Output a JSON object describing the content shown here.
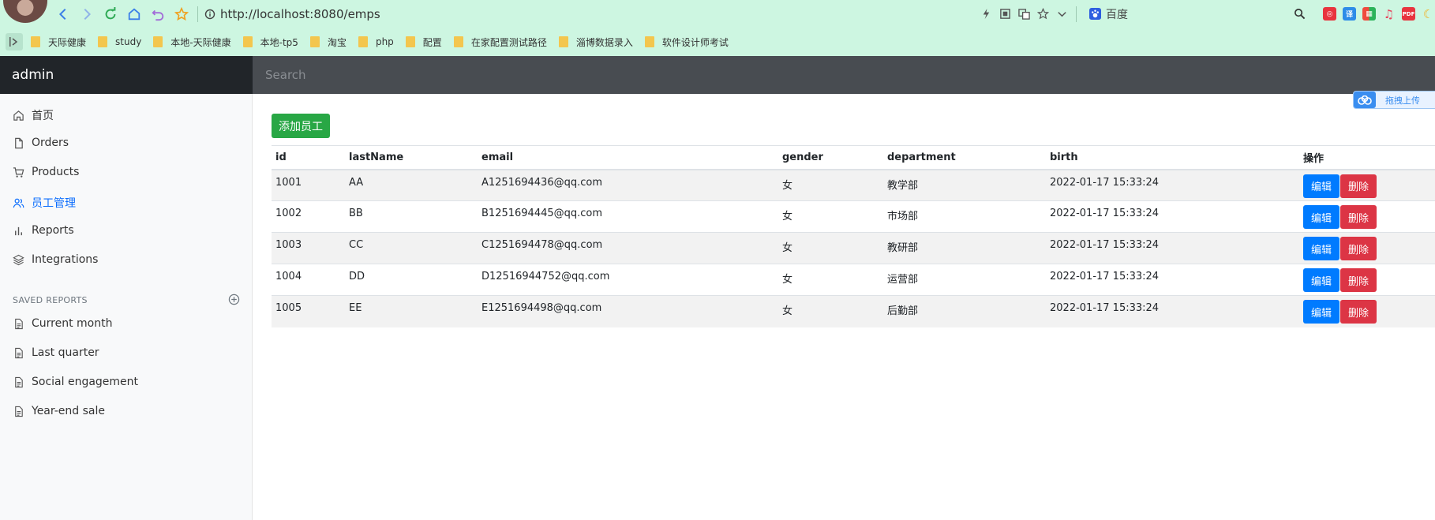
{
  "browser": {
    "url": "http://localhost:8080/emps",
    "search_engine": "百度",
    "bookmarks": [
      "天际健康",
      "study",
      "本地-天际健康",
      "本地-tp5",
      "淘宝",
      "php",
      "配置",
      "在家配置测试路径",
      "淄博数据录入",
      "软件设计师考试"
    ],
    "pdf_ext_label": "PDF"
  },
  "app": {
    "brand": "admin",
    "search_placeholder": "Search"
  },
  "sidebar": {
    "items": [
      {
        "label": "首页",
        "icon": "home-icon"
      },
      {
        "label": "Orders",
        "icon": "file-icon"
      },
      {
        "label": "Products",
        "icon": "cart-icon"
      },
      {
        "label": "员工管理",
        "icon": "users-icon"
      },
      {
        "label": "Reports",
        "icon": "bar-chart-icon"
      },
      {
        "label": "Integrations",
        "icon": "layers-icon"
      }
    ],
    "saved_heading": "SAVED REPORTS",
    "saved_reports": [
      "Current month",
      "Last quarter",
      "Social engagement",
      "Year-end sale"
    ]
  },
  "main": {
    "add_button": "添加员工",
    "table": {
      "headers": [
        "id",
        "lastName",
        "email",
        "gender",
        "department",
        "birth",
        "操作"
      ],
      "rows": [
        [
          "1001",
          "AA",
          "A1251694436@qq.com",
          "女",
          "教学部",
          "2022-01-17 15:33:24"
        ],
        [
          "1002",
          "BB",
          "B1251694445@qq.com",
          "女",
          "市场部",
          "2022-01-17 15:33:24"
        ],
        [
          "1003",
          "CC",
          "C1251694478@qq.com",
          "女",
          "教研部",
          "2022-01-17 15:33:24"
        ],
        [
          "1004",
          "DD",
          "D12516944752@qq.com",
          "女",
          "运营部",
          "2022-01-17 15:33:24"
        ],
        [
          "1005",
          "EE",
          "E1251694498@qq.com",
          "女",
          "后勤部",
          "2022-01-17 15:33:24"
        ]
      ],
      "edit_label": "编辑",
      "delete_label": "删除"
    }
  },
  "baidu_upload": {
    "label": "拖拽上传"
  },
  "colors": {
    "chrome_bg": "#cdf6e1",
    "brand_bg": "#212529",
    "search_bg": "#484c51",
    "active_link": "#0d6efd",
    "add_button": "#28a745",
    "edit_button": "#007bff",
    "delete_button": "#dc3545"
  }
}
